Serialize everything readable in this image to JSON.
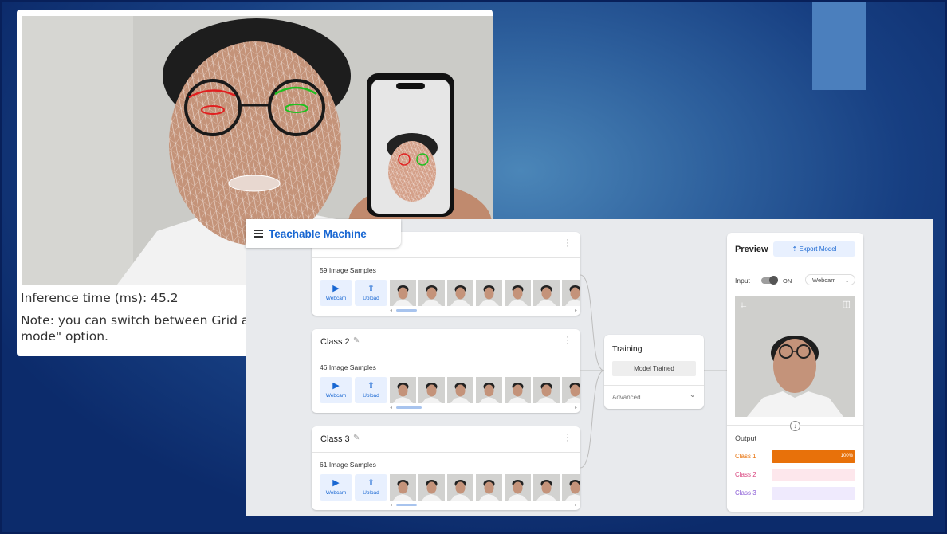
{
  "face_panel": {
    "inference_label": "Inference time (ms): 45.2",
    "note_line1": "Note: you can switch between Grid ar",
    "note_line2": "mode\" option."
  },
  "teachable": {
    "title": "Teachable Machine",
    "webcam_label": "Webcam",
    "upload_label": "Upload",
    "classes": [
      {
        "name": "",
        "samples": "59 Image Samples"
      },
      {
        "name": "Class 2",
        "samples": "46 Image Samples"
      },
      {
        "name": "Class 3",
        "samples": "61 Image Samples"
      }
    ],
    "training": {
      "title": "Training",
      "button": "Model Trained",
      "advanced": "Advanced"
    },
    "preview": {
      "title": "Preview",
      "export": "Export Model",
      "input_label": "Input",
      "toggle_state": "ON",
      "source": "Webcam",
      "output_label": "Output",
      "outputs": [
        {
          "name": "Class 1",
          "value": 1.0,
          "pct_label": "100%",
          "color": "#e8710a",
          "track": "#fde5d3"
        },
        {
          "name": "Class 2",
          "value": 0.0,
          "pct_label": "",
          "color": "#d9457f",
          "track": "#fde7ec"
        },
        {
          "name": "Class 3",
          "value": 0.0,
          "pct_label": "",
          "color": "#8b5cd6",
          "track": "#efeafd"
        }
      ]
    }
  },
  "colors": {
    "accent": "#1967d2",
    "background": "#173f82"
  }
}
